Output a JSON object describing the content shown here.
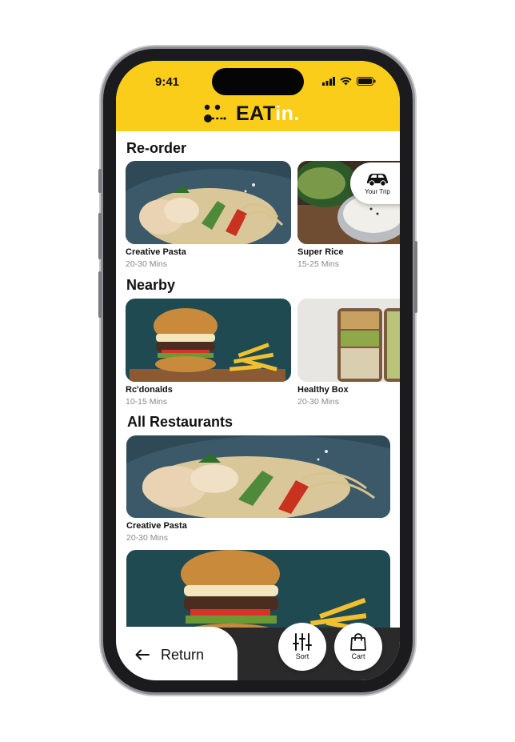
{
  "status_bar": {
    "time": "9:41"
  },
  "brand": {
    "logo_text": "EAT",
    "logo_suffix": "in."
  },
  "sections": {
    "reorder": {
      "title": "Re-order",
      "items": [
        {
          "name": "Creative Pasta",
          "time": "20-30 Mins"
        },
        {
          "name": "Super Rice",
          "time": "15-25 Mins"
        }
      ]
    },
    "nearby": {
      "title": "Nearby",
      "items": [
        {
          "name": "Rc'donalds",
          "time": "10-15 Mins"
        },
        {
          "name": "Healthy Box",
          "time": "20-30 Mins"
        }
      ]
    },
    "all": {
      "title": "All Restaurants",
      "items": [
        {
          "name": "Creative Pasta",
          "time": "20-30 Mins"
        }
      ]
    }
  },
  "trip_button": {
    "label": "Your Trip"
  },
  "bottom_bar": {
    "return_label": "Return",
    "sort_label": "Sort",
    "cart_label": "Cart"
  },
  "colors": {
    "brand_yellow": "#f9cd1a",
    "text_dark": "#111111",
    "text_muted": "#8a8a8a"
  },
  "icons": [
    "signal-icon",
    "wifi-icon",
    "battery-icon",
    "logo-icon",
    "car-icon",
    "arrow-left-icon",
    "sliders-icon",
    "bag-icon"
  ]
}
